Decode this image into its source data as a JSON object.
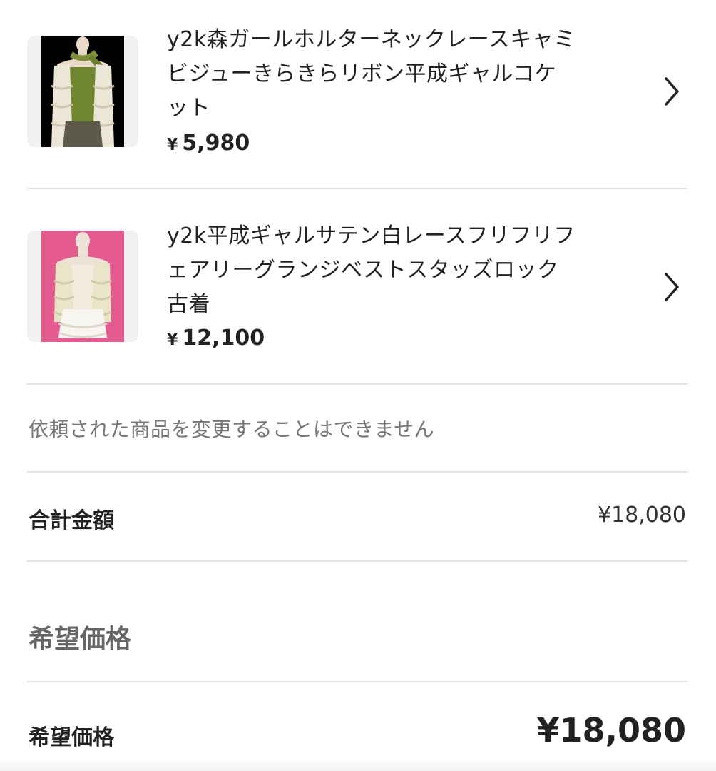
{
  "items": [
    {
      "title_lines": [
        "y2k森ガールホルターネックレースキャミ",
        "ビジューきらきらリボン平成ギャルコケ",
        "ット"
      ],
      "currency": "¥",
      "price": "5,980",
      "thumb_icon": "lace-camisole-green-photo",
      "chevron_icon": "chevron-right-icon"
    },
    {
      "title_lines": [
        "y2k平成ギャルサテン白レースフリフリフ",
        "ェアリーグランジベストスタッズロック",
        "古着"
      ],
      "currency": "¥",
      "price": "12,100",
      "thumb_icon": "lace-vest-white-photo",
      "chevron_icon": "chevron-right-icon"
    }
  ],
  "notice": "依頼された商品を変更することはできません",
  "total": {
    "label": "合計金額",
    "value": "¥18,080"
  },
  "desired_section": {
    "heading": "希望価格"
  },
  "desired": {
    "label": "希望価格",
    "value": "¥18,080"
  },
  "colors": {
    "text": "#222222",
    "muted": "#777777",
    "heading_gray": "#666666",
    "divider": "#e4e4e4",
    "thumb_bg": "#f1f1f1",
    "photo1_bg": "#000000",
    "photo2_bg": "#e65b8f"
  }
}
